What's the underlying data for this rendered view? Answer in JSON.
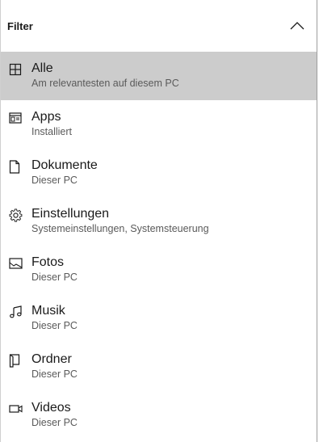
{
  "header": {
    "title": "Filter",
    "collapse_icon": "chevron-up-icon"
  },
  "items": [
    {
      "title": "Alle",
      "subtitle": "Am relevantesten auf diesem PC",
      "icon": "grid-icon",
      "selected": true
    },
    {
      "title": "Apps",
      "subtitle": "Installiert",
      "icon": "app-window-icon",
      "selected": false
    },
    {
      "title": "Dokumente",
      "subtitle": "Dieser PC",
      "icon": "document-icon",
      "selected": false
    },
    {
      "title": "Einstellungen",
      "subtitle": "Systemeinstellungen, Systemsteuerung",
      "icon": "gear-icon",
      "selected": false
    },
    {
      "title": "Fotos",
      "subtitle": "Dieser PC",
      "icon": "photo-icon",
      "selected": false
    },
    {
      "title": "Musik",
      "subtitle": "Dieser PC",
      "icon": "music-note-icon",
      "selected": false
    },
    {
      "title": "Ordner",
      "subtitle": "Dieser PC",
      "icon": "folder-icon",
      "selected": false
    },
    {
      "title": "Videos",
      "subtitle": "Dieser PC",
      "icon": "video-camera-icon",
      "selected": false
    }
  ],
  "colors": {
    "selected_background": "#cccccc",
    "text_primary": "#1a1a1a",
    "text_secondary": "#5a5a5a"
  }
}
